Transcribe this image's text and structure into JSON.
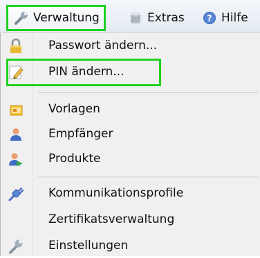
{
  "menubar": {
    "items": [
      {
        "label": "Verwaltung",
        "icon": "wrench-icon"
      },
      {
        "label": "Extras",
        "icon": "database-icon"
      },
      {
        "label": "Hilfe",
        "icon": "help-icon"
      }
    ]
  },
  "menu": {
    "items": [
      {
        "label": "Passwort ändern...",
        "icon": "lock-icon"
      },
      {
        "label": "PIN ändern...",
        "icon": "pencil-icon"
      },
      {
        "label": "Vorlagen",
        "icon": "template-icon"
      },
      {
        "label": "Empfänger",
        "icon": "person-icon"
      },
      {
        "label": "Produkte",
        "icon": "person-product-icon"
      },
      {
        "label": "Kommunikationsprofile",
        "icon": "plug-icon"
      },
      {
        "label": "Zertifikatsverwaltung",
        "icon": ""
      },
      {
        "label": "Einstellungen",
        "icon": "wrench-icon"
      }
    ]
  },
  "colors": {
    "highlight": "#1fd21f",
    "menu_background": "#f0f0f0",
    "separator": "#c8c8c8"
  }
}
